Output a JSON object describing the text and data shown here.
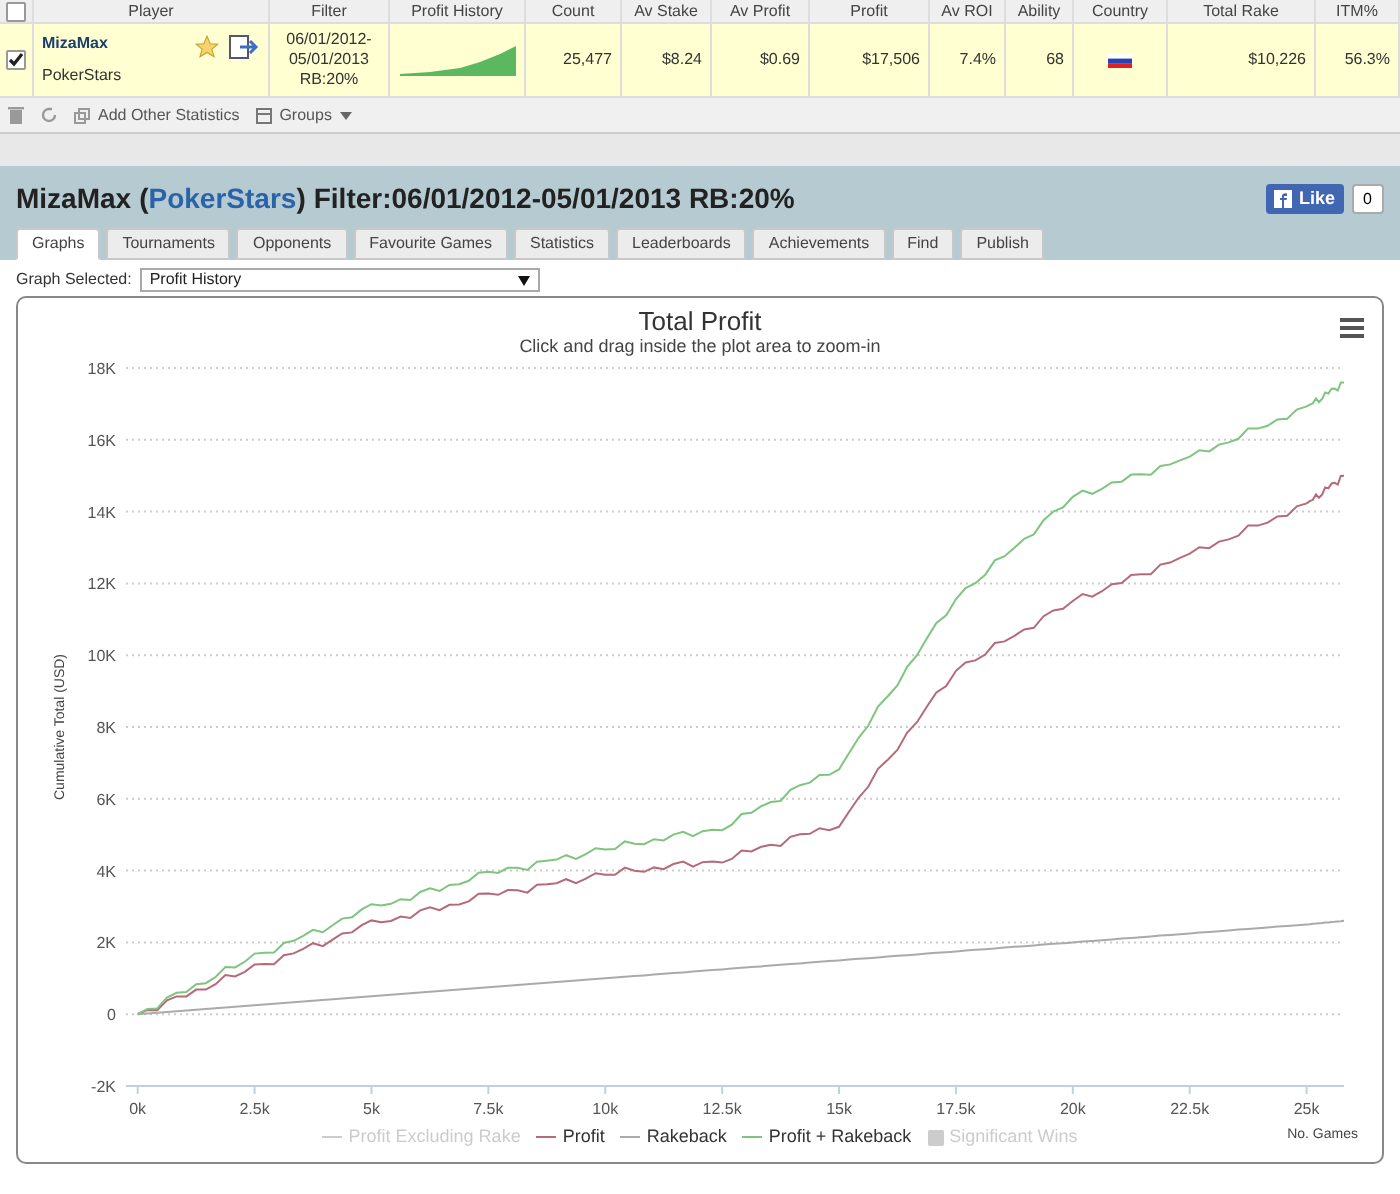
{
  "table": {
    "header_checked": false,
    "columns": [
      "Player",
      "Filter",
      "Profit History",
      "Count",
      "Av Stake",
      "Av Profit",
      "Profit",
      "Av ROI",
      "Ability",
      "Country",
      "Total Rake",
      "ITM%"
    ],
    "rows": [
      {
        "selected": true,
        "player": "MizaMax",
        "site": "PokerStars",
        "filter": [
          "06/01/2012-",
          "05/01/2013",
          "RB:20%"
        ],
        "count": "25,477",
        "av_stake": "$8.24",
        "av_profit": "$0.69",
        "profit": "$17,506",
        "av_roi": "7.4%",
        "ability": "68",
        "total_rake": "$10,226",
        "itm": "56.3%"
      }
    ]
  },
  "toolbar": {
    "items": [
      "Add Other Statistics",
      "Groups"
    ]
  },
  "panel": {
    "title_player": "MizaMax",
    "title_site": [
      "(",
      "PokerStars",
      ")"
    ],
    "title_filter": "Filter:06/01/2012-05/01/2013 RB:20%",
    "like_label": "Like",
    "like_count": "0",
    "tabs": [
      {
        "label": "Graphs",
        "selected": true
      },
      {
        "label": "Tournaments",
        "selected": false
      },
      {
        "label": "Opponents",
        "selected": false
      },
      {
        "label": "Favourite Games",
        "selected": false
      },
      {
        "label": "Statistics",
        "selected": false
      },
      {
        "label": "Leaderboards",
        "selected": false
      },
      {
        "label": "Achievements",
        "selected": false
      },
      {
        "label": "Find",
        "selected": false
      },
      {
        "label": "Publish",
        "selected": false
      }
    ],
    "graph_label": "Graph Selected:",
    "graph_value": "Profit History",
    "chart_data": {
      "type": "line",
      "title": "Total Profit",
      "subtitle": "Click and drag inside the plot area to zoom-in",
      "ylabel": "Cumulative Total (USD)",
      "xlabel": "No. Games",
      "grid": true,
      "x": [
        0,
        2500,
        5000,
        7500,
        10000,
        12500,
        15000,
        17500,
        20000,
        22500,
        25000,
        25800
      ],
      "series": [
        {
          "name": "Profit",
          "color": "#b56a7a",
          "values": [
            0,
            1300,
            2500,
            3300,
            3900,
            4300,
            5300,
            9600,
            11500,
            12800,
            14200,
            15000
          ]
        },
        {
          "name": "Rakeback",
          "color": "#aaaaaa",
          "values": [
            0,
            250,
            500,
            750,
            1000,
            1250,
            1500,
            1750,
            2000,
            2250,
            2500,
            2600
          ]
        },
        {
          "name": "Profit + Rakeback",
          "color": "#7fc47f",
          "values": [
            0,
            1600,
            2950,
            3900,
            4600,
            5200,
            6900,
            11600,
            14400,
            15500,
            16900,
            17600
          ]
        }
      ],
      "xlim": [
        -250,
        25800
      ],
      "ylim": [
        -2000,
        18000
      ],
      "yticks": [
        {
          "value": -2000,
          "label": "-2K"
        },
        {
          "value": 0,
          "label": "0"
        },
        {
          "value": 2000,
          "label": "2K"
        },
        {
          "value": 4000,
          "label": "4K"
        },
        {
          "value": 6000,
          "label": "6K"
        },
        {
          "value": 8000,
          "label": "8K"
        },
        {
          "value": 10000,
          "label": "10K"
        },
        {
          "value": 12000,
          "label": "12K"
        },
        {
          "value": 14000,
          "label": "14K"
        },
        {
          "value": 16000,
          "label": "16K"
        },
        {
          "value": 18000,
          "label": "18K"
        }
      ],
      "xticks": [
        {
          "value": 0,
          "label": "0k"
        },
        {
          "value": 2500,
          "label": "2.5k"
        },
        {
          "value": 5000,
          "label": "5k"
        },
        {
          "value": 7500,
          "label": "7.5k"
        },
        {
          "value": 10000,
          "label": "10k"
        },
        {
          "value": 12500,
          "label": "12.5k"
        },
        {
          "value": 15000,
          "label": "15k"
        },
        {
          "value": 17500,
          "label": "17.5k"
        },
        {
          "value": 20000,
          "label": "20k"
        },
        {
          "value": 22500,
          "label": "22.5k"
        },
        {
          "value": 25000,
          "label": "25k"
        }
      ]
    },
    "legend": [
      {
        "kind": "line",
        "label": "Profit Excluding Rake",
        "visible": false
      },
      {
        "kind": "series"
      },
      {
        "kind": "series"
      },
      {
        "kind": "series"
      },
      {
        "kind": "box",
        "label": "Significant Wins",
        "visible": false
      }
    ]
  }
}
